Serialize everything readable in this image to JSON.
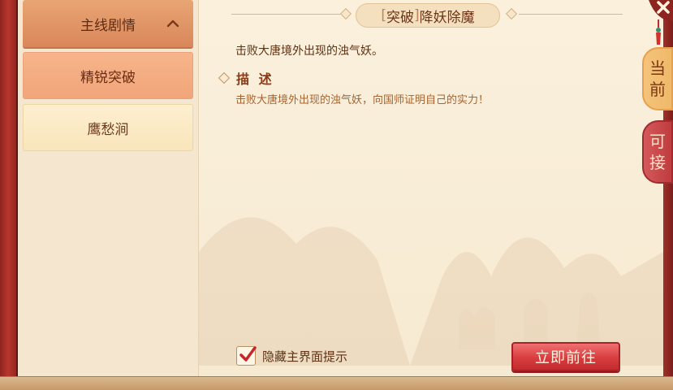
{
  "sidebar": {
    "category": {
      "label": "主线剧情",
      "icon": "chevron-up-icon"
    },
    "items": [
      {
        "label": "精锐突破",
        "state": "selected"
      },
      {
        "label": "鹰愁涧",
        "state": "normal"
      }
    ]
  },
  "quest": {
    "title_open": "[",
    "title_tag": "突破",
    "title_close": "]",
    "title_name": "降妖除魔",
    "objective": "击败大唐境外出现的浊气妖。",
    "description_heading": "描  述",
    "description_text": "击败大唐境外出现的浊气妖，向国师证明自己的实力！"
  },
  "footer": {
    "hide_tip_label": "隐藏主界面提示",
    "hide_tip_checked": true,
    "go_button_label": "立即前往"
  },
  "tabs": {
    "current": {
      "line1": "当",
      "line2": "前"
    },
    "available": {
      "line1": "可",
      "line2": "接"
    }
  },
  "colors": {
    "accent_red": "#d83d3f",
    "panel_bg": "#f7ead2",
    "sidebar_active": "#f1a57a",
    "tab_current": "#f0b96a"
  }
}
